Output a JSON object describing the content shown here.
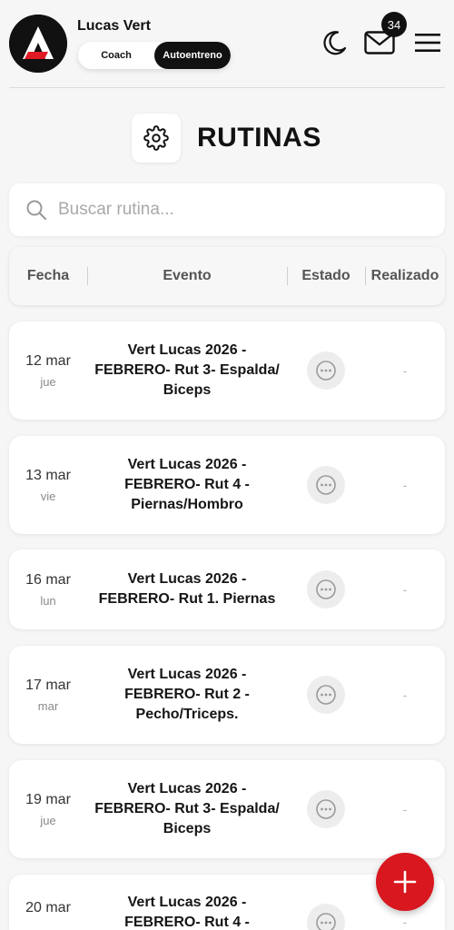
{
  "header": {
    "user_name": "Lucas Vert",
    "modes": [
      "Coach",
      "Autoentreno"
    ],
    "active_mode": "Autoentreno",
    "mail_badge": "34",
    "icons": [
      "logo",
      "moon-icon",
      "mail-icon",
      "menu-icon"
    ]
  },
  "title": {
    "icon": "gear-icon",
    "text": "RUTINAS"
  },
  "search": {
    "placeholder": "Buscar rutina...",
    "value": ""
  },
  "table": {
    "columns": [
      "Fecha",
      "Evento",
      "Estado",
      "Realizado"
    ],
    "rows": [
      {
        "date": "12 mar",
        "weekday": "jue",
        "event": "Vert Lucas 2026 - FEBRERO- Rut 3- Espalda/ Biceps",
        "status_icon": "more-icon",
        "done": "-"
      },
      {
        "date": "13 mar",
        "weekday": "vie",
        "event": "Vert Lucas 2026 - FEBRERO- Rut 4 - Piernas/Hombro",
        "status_icon": "more-icon",
        "done": "-"
      },
      {
        "date": "16 mar",
        "weekday": "lun",
        "event": "Vert Lucas 2026 - FEBRERO- Rut 1. Piernas",
        "status_icon": "more-icon",
        "done": "-"
      },
      {
        "date": "17 mar",
        "weekday": "mar",
        "event": "Vert Lucas 2026 - FEBRERO- Rut 2 - Pecho/Triceps.",
        "status_icon": "more-icon",
        "done": "-"
      },
      {
        "date": "19 mar",
        "weekday": "jue",
        "event": "Vert Lucas 2026 - FEBRERO- Rut 3- Espalda/ Biceps",
        "status_icon": "more-icon",
        "done": "-"
      },
      {
        "date": "20 mar",
        "weekday": "",
        "event": "Vert Lucas 2026 - FEBRERO- Rut 4 -",
        "status_icon": "more-icon",
        "done": "-"
      }
    ]
  },
  "fab": {
    "icon": "plus-icon"
  },
  "colors": {
    "accent": "#d8171e",
    "dark": "#111111",
    "background": "#f6f6f6"
  }
}
